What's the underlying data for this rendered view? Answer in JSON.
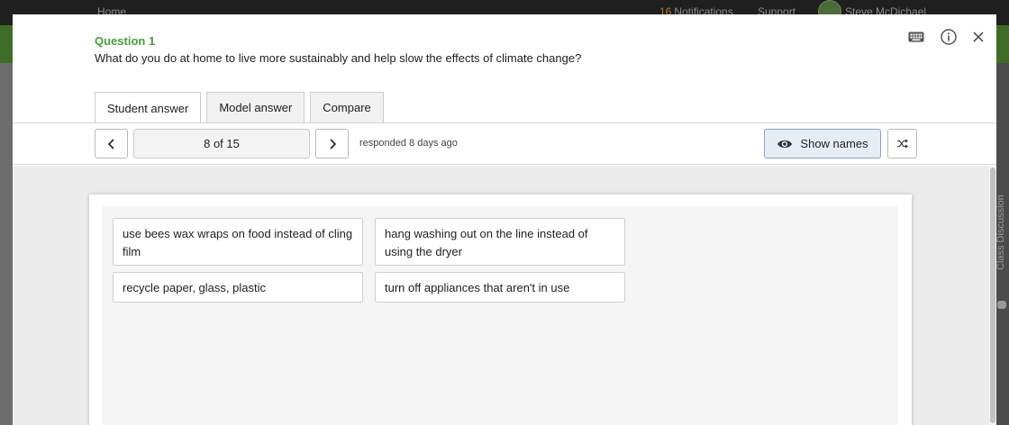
{
  "background": {
    "nav": {
      "home": "Home",
      "notifications_count": "16",
      "notifications_label": "Notifications",
      "support": "Support",
      "user_name": "Steve McDichael"
    },
    "sidebar_label": "Class Discussion"
  },
  "question": {
    "label": "Question 1",
    "text": "What do you do at home to live more sustainably and help slow the effects of climate change?"
  },
  "toolbar_icons": [
    "keyboard-icon",
    "info-icon",
    "close-icon"
  ],
  "tabs": [
    {
      "label": "Student answer",
      "active": true
    },
    {
      "label": "Model answer",
      "active": false
    },
    {
      "label": "Compare",
      "active": false
    }
  ],
  "navigation": {
    "counter": "8 of 15",
    "responded": "responded 8 days ago",
    "show_names_label": "Show names"
  },
  "answers": [
    "use bees wax wraps on food instead of cling film",
    "hang washing out on the line instead of using the dryer",
    "recycle paper, glass, plastic",
    "turn off appliances that aren't in use"
  ],
  "colors": {
    "accent_green": "#45a13a",
    "show_names_bg": "#e7edf4"
  }
}
